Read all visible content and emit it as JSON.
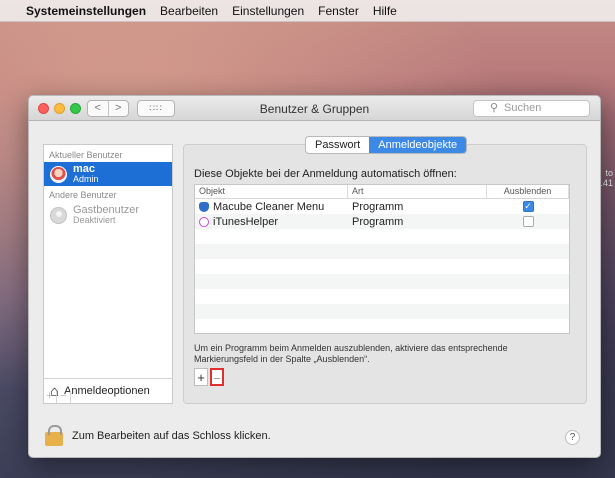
{
  "menubar": {
    "apple": "",
    "app": "Systemeinstellungen",
    "items": [
      "Bearbeiten",
      "Einstellungen",
      "Fenster",
      "Hilfe"
    ]
  },
  "desktop": {
    "side_text_1": "to",
    "side_text_2": ".41"
  },
  "window": {
    "title": "Benutzer & Gruppen",
    "search_placeholder": "Suchen",
    "nav_back": "<",
    "nav_forward": ">",
    "grid": "∷∷"
  },
  "sidebar": {
    "current_header": "Aktueller Benutzer",
    "current_user": {
      "name": "mac",
      "role": "Admin"
    },
    "other_header": "Andere Benutzer",
    "guest_user": {
      "name": "Gastbenutzer",
      "role": "Deaktiviert"
    },
    "login_options": "Anmeldeoptionen",
    "bar_add": "+",
    "bar_remove": "−"
  },
  "tabs": [
    {
      "label": "Passwort",
      "active": false
    },
    {
      "label": "Anmeldeobjekte",
      "active": true
    }
  ],
  "panel": {
    "heading": "Diese Objekte bei der Anmeldung automatisch öffnen:",
    "columns": [
      "Objekt",
      "Art",
      "Ausblenden"
    ],
    "rows": [
      {
        "name": "Macube Cleaner Menu",
        "kind": "Programm",
        "hide": true,
        "icon": "shield-icon"
      },
      {
        "name": "iTunesHelper",
        "kind": "Programm",
        "hide": false,
        "icon": "itunes-icon"
      }
    ],
    "note": "Um ein Programm beim Anmelden auszublenden, aktiviere das entsprechende Markierungsfeld in der Spalte „Ausblenden“.",
    "add": "+",
    "remove": "−"
  },
  "footer": {
    "lock_text": "Zum Bearbeiten auf das Schloss klicken.",
    "help": "?"
  },
  "colors": {
    "accent": "#3d8ae6",
    "highlight_border": "#e0302c",
    "selection": "#1d6fd6"
  }
}
